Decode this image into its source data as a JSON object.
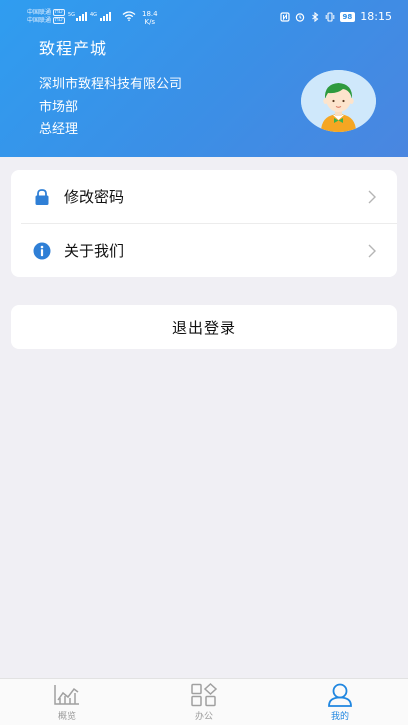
{
  "status_bar": {
    "carrier1": "中国联通",
    "carrier2": "中国联通",
    "hd": "HD",
    "sig1_label": "5G",
    "sig2_label": "4G",
    "net_speed_value": "18.4",
    "net_speed_unit": "K/s",
    "battery": "98",
    "time": "18:15"
  },
  "header": {
    "app_title": "致程产城",
    "company": "深圳市致程科技有限公司",
    "department": "市场部",
    "role": "总经理"
  },
  "menu": {
    "items": [
      {
        "label": "修改密码",
        "icon": "lock-icon"
      },
      {
        "label": "关于我们",
        "icon": "info-icon"
      }
    ]
  },
  "logout": {
    "label": "退出登录"
  },
  "tabbar": {
    "tabs": [
      {
        "label": "概览",
        "icon": "chart-icon",
        "active": false
      },
      {
        "label": "办公",
        "icon": "grid-icon",
        "active": false
      },
      {
        "label": "我的",
        "icon": "user-icon",
        "active": true
      }
    ]
  },
  "colors": {
    "header_gradient_start": "#2f9df0",
    "header_gradient_end": "#4a86e0",
    "accent": "#1f86e0",
    "lock_icon": "#2f7fd6",
    "background": "#f0eff4"
  }
}
